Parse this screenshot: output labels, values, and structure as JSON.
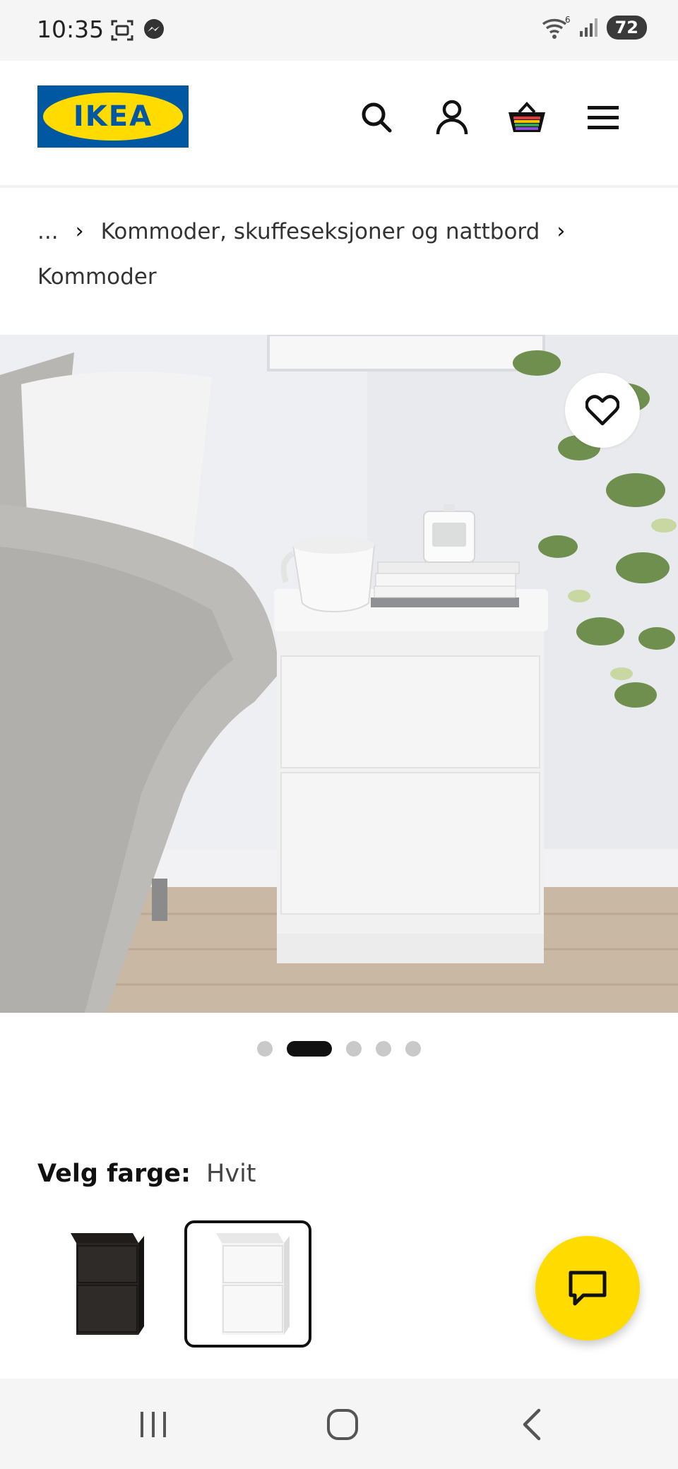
{
  "status_bar": {
    "time": "10:35",
    "battery": "72",
    "wifi_badge": "6",
    "left_icons": [
      "screenshot-icon",
      "messenger-icon"
    ],
    "right_icons": [
      "wifi-icon",
      "signal-icon"
    ]
  },
  "header": {
    "logo_text": "IKEA",
    "icons": [
      "search-icon",
      "account-icon",
      "basket-icon",
      "menu-icon"
    ]
  },
  "breadcrumb": {
    "ellipsis": "...",
    "separator": "›",
    "parent": "Kommoder, skuffeseksjoner og nattbord",
    "current": "Kommoder"
  },
  "gallery": {
    "image_alt": "White two-drawer chest beside a bed",
    "dots_total": 5,
    "active_index": 1
  },
  "color_select": {
    "label": "Velg farge:",
    "selected_value": "Hvit",
    "swatches": [
      {
        "name": "black-brown",
        "color": "#2a2624"
      },
      {
        "name": "white",
        "color": "#f4f4f4"
      }
    ]
  },
  "colors": {
    "ikea_blue": "#0058a3",
    "ikea_yellow": "#ffdb00"
  },
  "nav_bar": {
    "icons": [
      "recents-icon",
      "home-icon",
      "back-icon"
    ]
  }
}
